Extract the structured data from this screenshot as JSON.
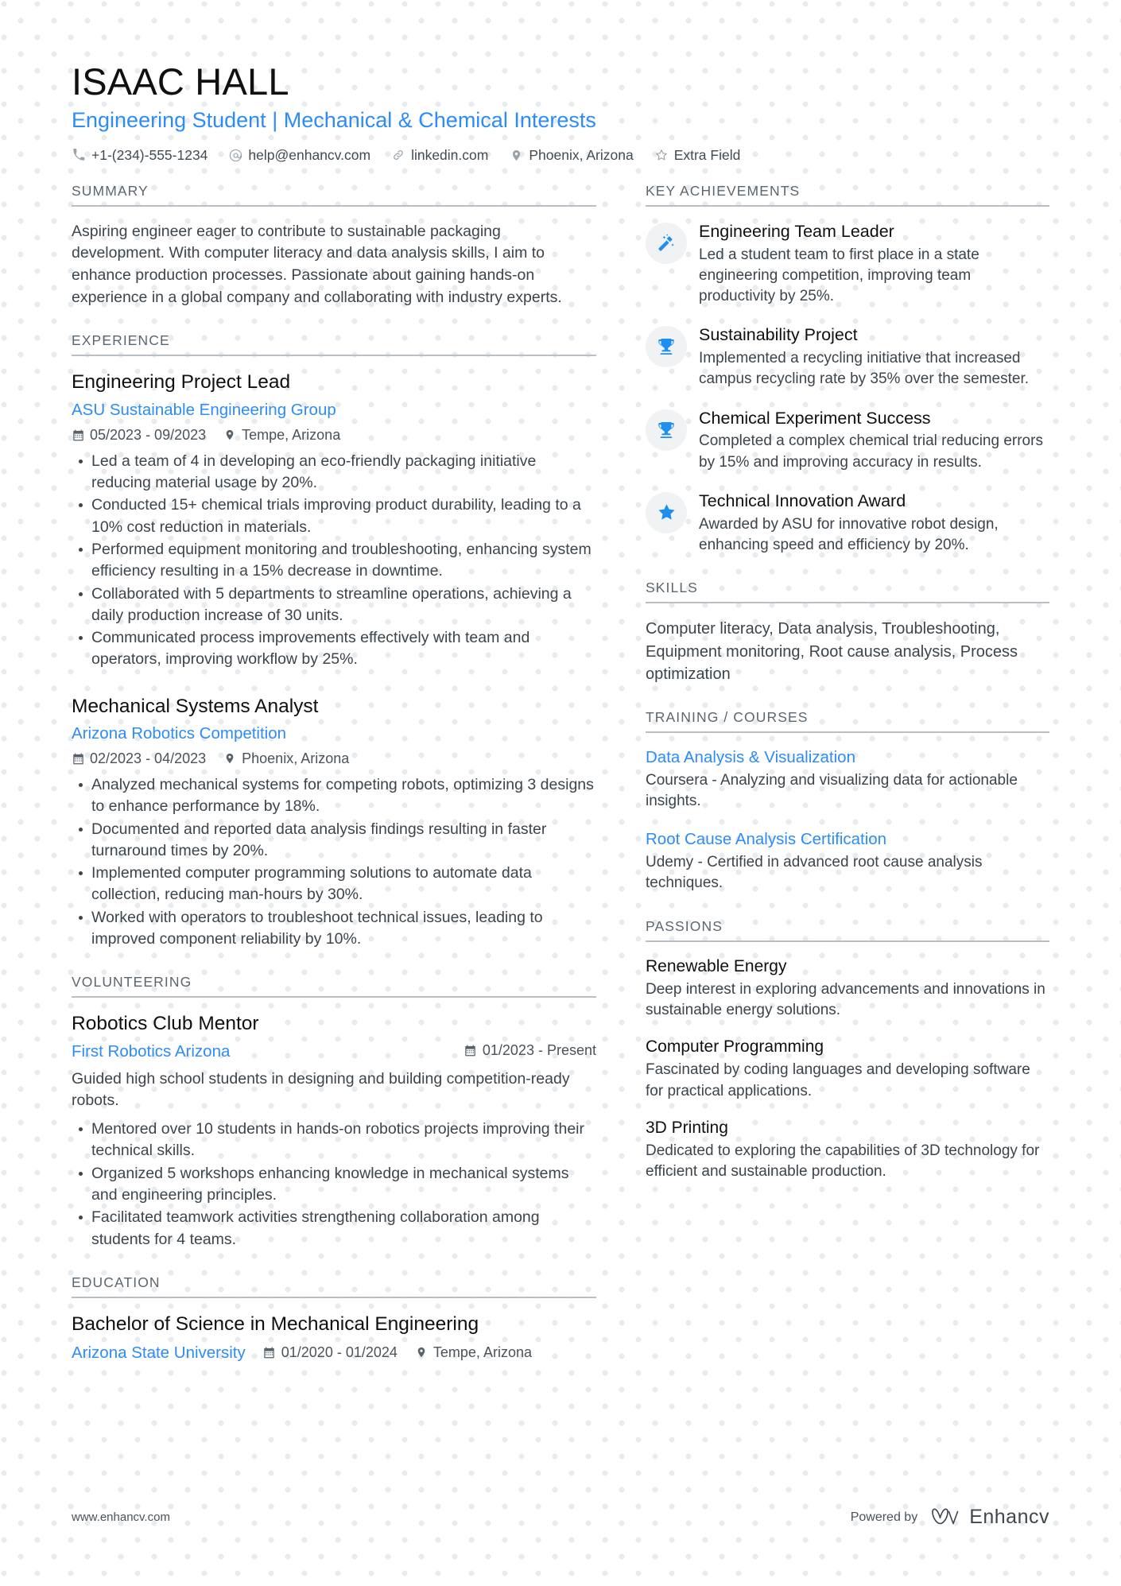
{
  "theme": {
    "accent": "#2d8cf5",
    "icon_blue": "#1e8ef1",
    "text": "#3c444c",
    "heading": "#5c666f",
    "dot": "#e9ebed"
  },
  "header": {
    "name": "ISAAC HALL",
    "headline": "Engineering Student | Mechanical & Chemical Interests",
    "contacts": [
      {
        "icon": "phone-icon",
        "text": "+1-(234)-555-1234"
      },
      {
        "icon": "email-icon",
        "text": "help@enhancv.com"
      },
      {
        "icon": "link-icon",
        "text": "linkedin.com"
      },
      {
        "icon": "location-pin-icon",
        "text": "Phoenix, Arizona"
      },
      {
        "icon": "star-outline-icon",
        "text": "Extra Field"
      }
    ]
  },
  "left": {
    "summary": {
      "title": "SUMMARY",
      "text": "Aspiring engineer eager to contribute to sustainable packaging development. With computer literacy and data analysis skills, I aim to enhance production processes. Passionate about gaining hands-on experience in a global company and collaborating with industry experts."
    },
    "experience": {
      "title": "EXPERIENCE",
      "entries": [
        {
          "role": "Engineering Project Lead",
          "org": "ASU Sustainable Engineering Group",
          "dates": "05/2023 - 09/2023",
          "location": "Tempe, Arizona",
          "bullets": [
            "Led a team of 4 in developing an eco-friendly packaging initiative reducing material usage by 20%.",
            "Conducted 15+ chemical trials improving product durability, leading to a 10% cost reduction in materials.",
            "Performed equipment monitoring and troubleshooting, enhancing system efficiency resulting in a 15% decrease in downtime.",
            "Collaborated with 5 departments to streamline operations, achieving a daily production increase of 30 units.",
            "Communicated process improvements effectively with team and operators, improving workflow by 25%."
          ]
        },
        {
          "role": "Mechanical Systems Analyst",
          "org": "Arizona Robotics Competition",
          "dates": "02/2023 - 04/2023",
          "location": "Phoenix, Arizona",
          "bullets": [
            "Analyzed mechanical systems for competing robots, optimizing 3 designs to enhance performance by 18%.",
            "Documented and reported data analysis findings resulting in faster turnaround times by 20%.",
            "Implemented computer programming solutions to automate data collection, reducing man-hours by 30%.",
            "Worked with operators to troubleshoot technical issues, leading to improved component reliability by 10%."
          ]
        }
      ]
    },
    "volunteering": {
      "title": "VOLUNTEERING",
      "entries": [
        {
          "role": "Robotics Club Mentor",
          "org": "First Robotics Arizona",
          "dates": "01/2023 - Present",
          "description": "Guided high school students in designing and building competition-ready robots.",
          "bullets": [
            "Mentored over 10 students in hands-on robotics projects improving their technical skills.",
            "Organized 5 workshops enhancing knowledge in mechanical systems and engineering principles.",
            "Facilitated teamwork activities strengthening collaboration among students for 4 teams."
          ]
        }
      ]
    },
    "education": {
      "title": "EDUCATION",
      "entries": [
        {
          "degree": "Bachelor of Science in Mechanical Engineering",
          "school": "Arizona State University",
          "dates": "01/2020 - 01/2024",
          "location": "Tempe, Arizona"
        }
      ]
    }
  },
  "right": {
    "achievements": {
      "title": "KEY ACHIEVEMENTS",
      "items": [
        {
          "icon": "magic-wand-icon",
          "title": "Engineering Team Leader",
          "text": "Led a student team to first place in a state engineering competition, improving team productivity by 25%."
        },
        {
          "icon": "trophy-icon",
          "title": "Sustainability Project",
          "text": "Implemented a recycling initiative that increased campus recycling rate by 35% over the semester."
        },
        {
          "icon": "trophy-icon",
          "title": "Chemical Experiment Success",
          "text": "Completed a complex chemical trial reducing errors by 15% and improving accuracy in results."
        },
        {
          "icon": "star-icon",
          "title": "Technical Innovation Award",
          "text": "Awarded by ASU for innovative robot design, enhancing speed and efficiency by 20%."
        }
      ]
    },
    "skills": {
      "title": "SKILLS",
      "text": "Computer literacy, Data analysis, Troubleshooting, Equipment monitoring, Root cause analysis, Process optimization"
    },
    "training": {
      "title": "TRAINING / COURSES",
      "items": [
        {
          "name": "Data Analysis & Visualization",
          "desc": "Coursera - Analyzing and visualizing data for actionable insights."
        },
        {
          "name": "Root Cause Analysis Certification",
          "desc": "Udemy - Certified in advanced root cause analysis techniques."
        }
      ]
    },
    "passions": {
      "title": "PASSIONS",
      "items": [
        {
          "name": "Renewable Energy",
          "desc": "Deep interest in exploring advancements and innovations in sustainable energy solutions."
        },
        {
          "name": "Computer Programming",
          "desc": "Fascinated by coding languages and developing software for practical applications."
        },
        {
          "name": "3D Printing",
          "desc": "Dedicated to exploring the capabilities of 3D technology for efficient and sustainable production."
        }
      ]
    }
  },
  "footer": {
    "url": "www.enhancv.com",
    "powered_by": "Powered by",
    "brand": "Enhancv"
  }
}
